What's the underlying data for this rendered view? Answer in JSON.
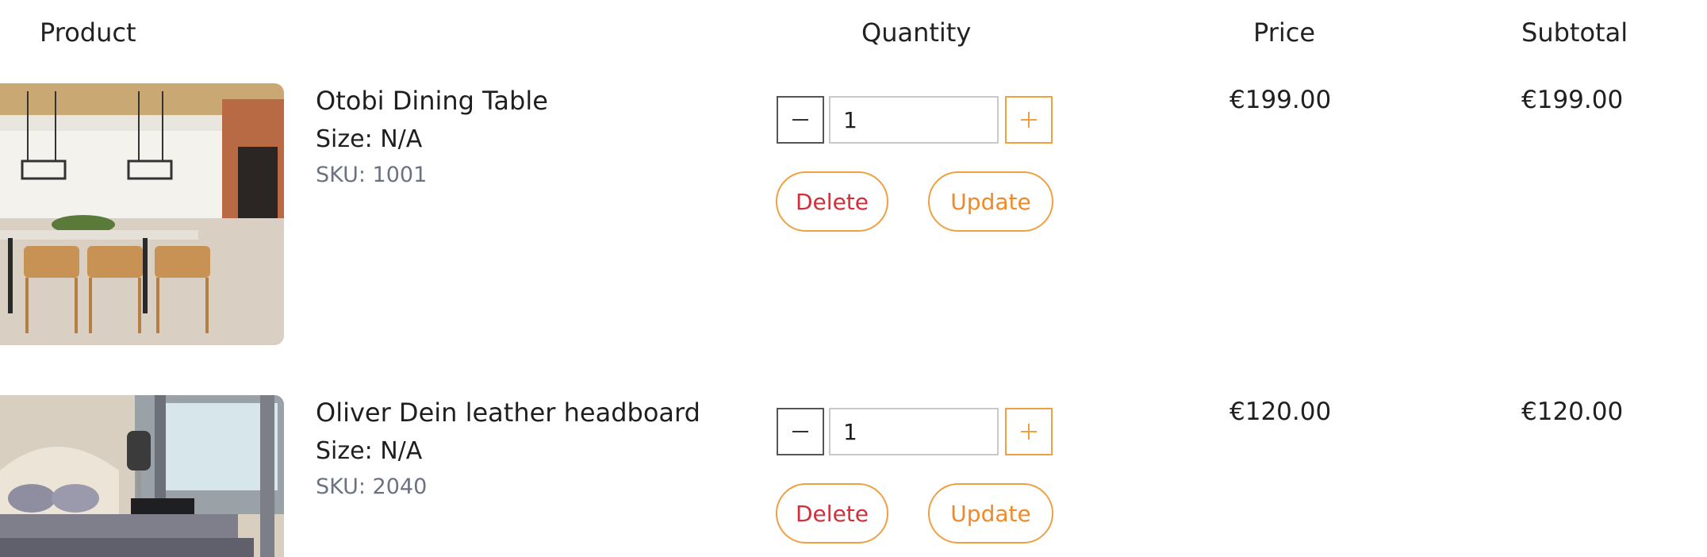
{
  "headers": {
    "product": "Product",
    "quantity": "Quantity",
    "price": "Price",
    "subtotal": "Subtotal"
  },
  "items": [
    {
      "name": "Otobi Dining Table",
      "size": "Size: N/A",
      "sku": "SKU: 1001",
      "quantity": "1",
      "delete_label": "Delete",
      "update_label": "Update",
      "price": "€199.00",
      "subtotal": "€199.00",
      "image_icon": "dining-room-photo"
    },
    {
      "name": "Oliver Dein leather headboard",
      "size": "Size: N/A",
      "sku": "SKU: 2040",
      "quantity": "1",
      "delete_label": "Delete",
      "update_label": "Update",
      "price": "€120.00",
      "subtotal": "€120.00",
      "image_icon": "bedroom-photo"
    }
  ],
  "colors": {
    "accent": "#f0a040",
    "delete": "#d0303a",
    "update": "#f08a28",
    "sku": "#6b7280"
  }
}
